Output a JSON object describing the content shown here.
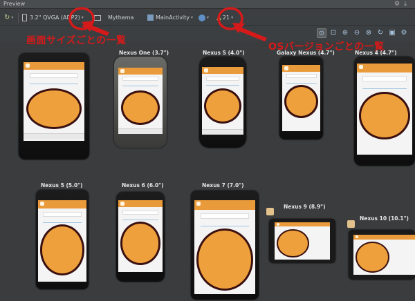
{
  "window": {
    "title": "Preview"
  },
  "toolbar": {
    "device": "3.2\" QVGA (ADP2)",
    "theme": "Mythema",
    "activity": "MainActivity",
    "api": "21"
  },
  "annotations": {
    "screen_size": "画面サイズごとの一覧",
    "os_version": "OSバージョンごとの一覧"
  },
  "devices": [
    {
      "label": "",
      "name": "3.2\" QVGA (ADP2)"
    },
    {
      "label": "Nexus One (3.7\")"
    },
    {
      "label": "Nexus S (4.0\")"
    },
    {
      "label": "Galaxy Nexus (4.7\")"
    },
    {
      "label": "Nexus 4 (4.7\")"
    },
    {
      "label": "Nexus 5 (5.0\")"
    },
    {
      "label": "Nexus 6 (6.0\")"
    },
    {
      "label": "Nexus 7 (7.0\")"
    },
    {
      "label": "Nexus 9 (8.9\")"
    },
    {
      "label": "Nexus 10 (10.1\")"
    }
  ],
  "app": {
    "nickname": "Nickname",
    "date": "2014/12",
    "counter": "0",
    "minus": "−",
    "plus": "+"
  },
  "colors": {
    "accent": "#e99a3a",
    "annotation": "#d61a1a",
    "orb": "#eea03c"
  }
}
